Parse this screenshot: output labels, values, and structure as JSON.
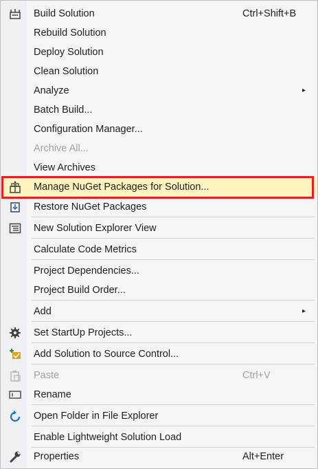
{
  "menu": {
    "items": [
      {
        "label": "Build Solution",
        "shortcut": "Ctrl+Shift+B",
        "icon": "build-icon"
      },
      {
        "label": "Rebuild Solution"
      },
      {
        "label": "Deploy Solution"
      },
      {
        "label": "Clean Solution"
      },
      {
        "label": "Analyze",
        "submenu": "▸"
      },
      {
        "label": "Batch Build..."
      },
      {
        "label": "Configuration Manager..."
      },
      {
        "label": "Archive All...",
        "disabled": true
      },
      {
        "label": "View Archives"
      },
      {
        "label": "Manage NuGet Packages for Solution...",
        "icon": "nuget-icon",
        "highlighted": true
      },
      {
        "label": "Restore NuGet Packages",
        "icon": "restore-packages-icon"
      },
      {
        "label": "New Solution Explorer View",
        "icon": "solution-explorer-icon"
      },
      {
        "label": "Calculate Code Metrics"
      },
      {
        "label": "Project Dependencies..."
      },
      {
        "label": "Project Build Order..."
      },
      {
        "label": "Add",
        "submenu": "▸"
      },
      {
        "label": "Set StartUp Projects...",
        "icon": "gear-icon"
      },
      {
        "label": "Add Solution to Source Control...",
        "icon": "source-control-icon"
      },
      {
        "label": "Paste",
        "shortcut": "Ctrl+V",
        "icon": "paste-icon",
        "disabled": true
      },
      {
        "label": "Rename",
        "icon": "rename-icon"
      },
      {
        "label": "Open Folder in File Explorer",
        "icon": "open-folder-icon"
      },
      {
        "label": "Enable Lightweight Solution Load"
      },
      {
        "label": "Properties",
        "shortcut": "Alt+Enter",
        "icon": "wrench-icon"
      }
    ]
  },
  "colors": {
    "highlight": "#fdf4bf",
    "callout_border": "#e41f26",
    "disabled_text": "#a2a2a2"
  }
}
